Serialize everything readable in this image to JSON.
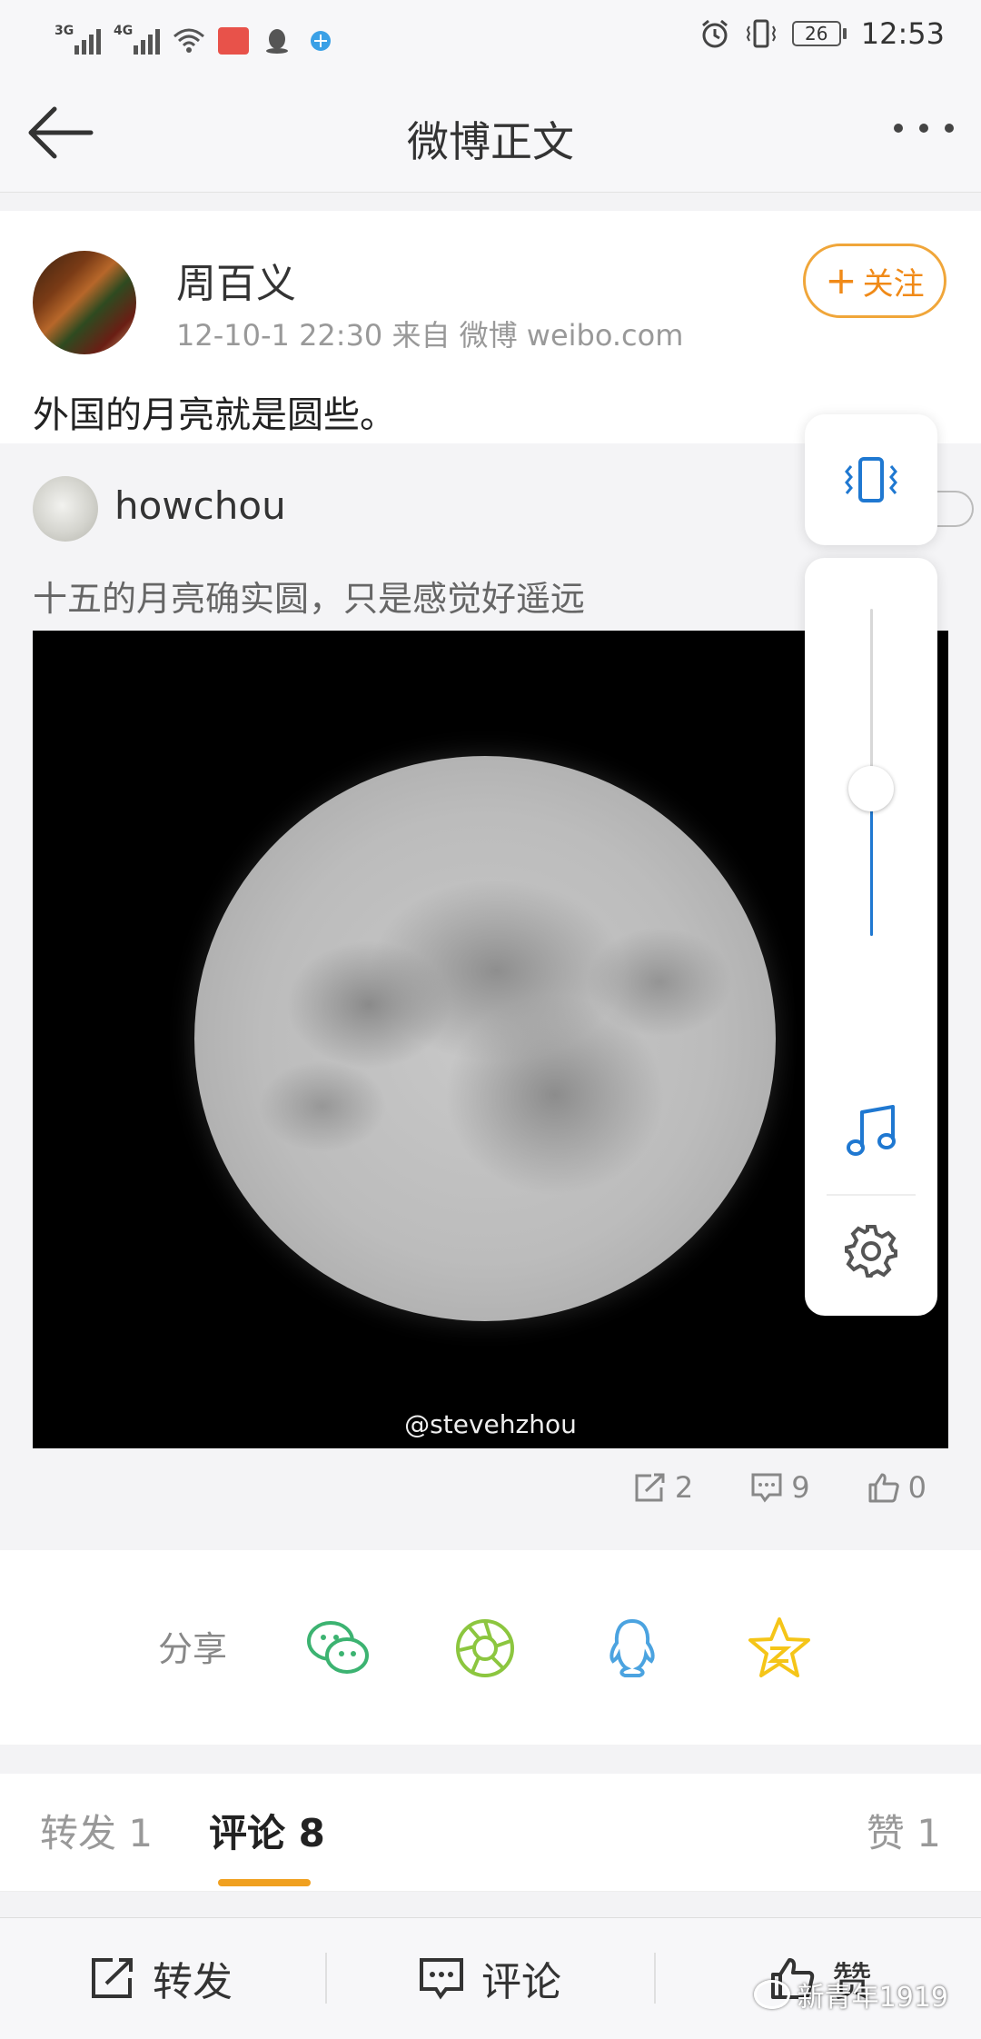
{
  "status_bar": {
    "network_1": "3G",
    "network_2": "4G",
    "battery": "26",
    "time": "12:53",
    "icons": [
      "signal-icon",
      "signal-icon",
      "wifi-icon",
      "app-notification-icon",
      "qq-icon",
      "browser-icon",
      "alarm-icon",
      "vibrate-icon",
      "battery-icon"
    ]
  },
  "nav": {
    "title": "微博正文",
    "back_icon": "back-arrow-icon",
    "more_icon": "more-dots-icon"
  },
  "post": {
    "author": "周百义",
    "meta": "12-10-1 22:30   来自 微博 weibo.com",
    "follow_label": "关注",
    "follow_color": "#f08a18",
    "text": "外国的月亮就是圆些。"
  },
  "retweet": {
    "user": "howchou",
    "text": "十五的月亮确实圆，只是感觉好遥远",
    "image_watermark": "@stevehzhou",
    "stats": {
      "reposts": "2",
      "comments": "9",
      "likes": "0"
    }
  },
  "share": {
    "label": "分享",
    "targets": [
      "wechat-icon",
      "moments-icon",
      "qq-icon",
      "qzone-icon"
    ]
  },
  "tabs": {
    "repost": "转发 1",
    "comment": "评论 8",
    "like": "赞 1",
    "active": "comment",
    "accent": "#f0a020"
  },
  "bottom_bar": {
    "repost": "转发",
    "comment": "评论",
    "like": "赞"
  },
  "volume_overlay": {
    "level": 0.45,
    "accent": "#1f78d1",
    "icons": [
      "vibrate-icon",
      "music-note-icon",
      "settings-gear-icon"
    ]
  },
  "watermark_brand": "新青年1919"
}
